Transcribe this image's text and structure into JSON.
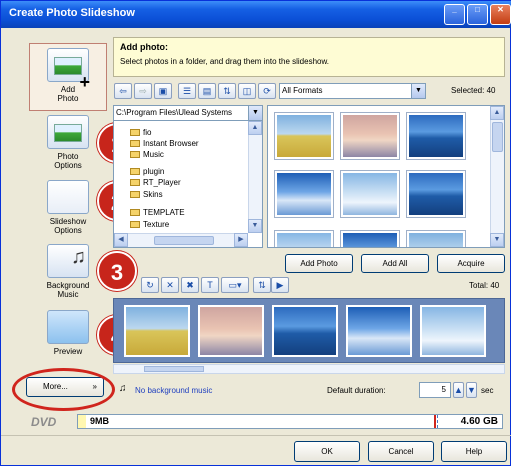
{
  "window": {
    "title": "Create Photo Slideshow",
    "minimize_glyph": "_",
    "maximize_glyph": "□",
    "close_glyph": "✕"
  },
  "sidebar": {
    "items": [
      {
        "label_line1": "Add",
        "label_line2": "Photo",
        "icon": "add-photo-icon"
      },
      {
        "label_line1": "Photo",
        "label_line2": "Options",
        "icon": "photo-options-icon"
      },
      {
        "label_line1": "Slideshow",
        "label_line2": "Options",
        "icon": "slideshow-options-icon"
      },
      {
        "label_line1": "Background",
        "label_line2": "Music",
        "icon": "background-music-icon"
      },
      {
        "label_line1": "Preview",
        "label_line2": "",
        "icon": "preview-icon"
      }
    ],
    "more_button": "More...",
    "more_glyph": "»"
  },
  "badges": [
    "1",
    "2",
    "3",
    "4"
  ],
  "info": {
    "title": "Add photo:",
    "text": "Select photos in a folder, and drag them into the slideshow."
  },
  "browser": {
    "formats_value": "All Formats",
    "selected": "Selected: 40",
    "path_value": "C:\\Program Files\\Ulead Systems",
    "folders": [
      "fio",
      "Instant Browser",
      "Music",
      "plugin",
      "RT_Player",
      "Skins",
      "TEMPLATE",
      "Texture"
    ]
  },
  "actions": {
    "add_photo": "Add Photo",
    "add_all": "Add All",
    "acquire": "Acquire"
  },
  "storyboard": {
    "total": "Total: 40"
  },
  "music": {
    "status": "No background music",
    "duration_label": "Default duration:",
    "duration_value": "5",
    "duration_unit": "sec"
  },
  "capacity": {
    "used": "9MB",
    "total": "4.60 GB",
    "disc_label": "DVD",
    "fill_fraction": 0.02
  },
  "footer": {
    "ok": "OK",
    "cancel": "Cancel",
    "help": "Help"
  },
  "colors": {
    "badge": "#c7251b",
    "title_bar": "#0b4fd6",
    "info_panel": "#fefcd4"
  }
}
